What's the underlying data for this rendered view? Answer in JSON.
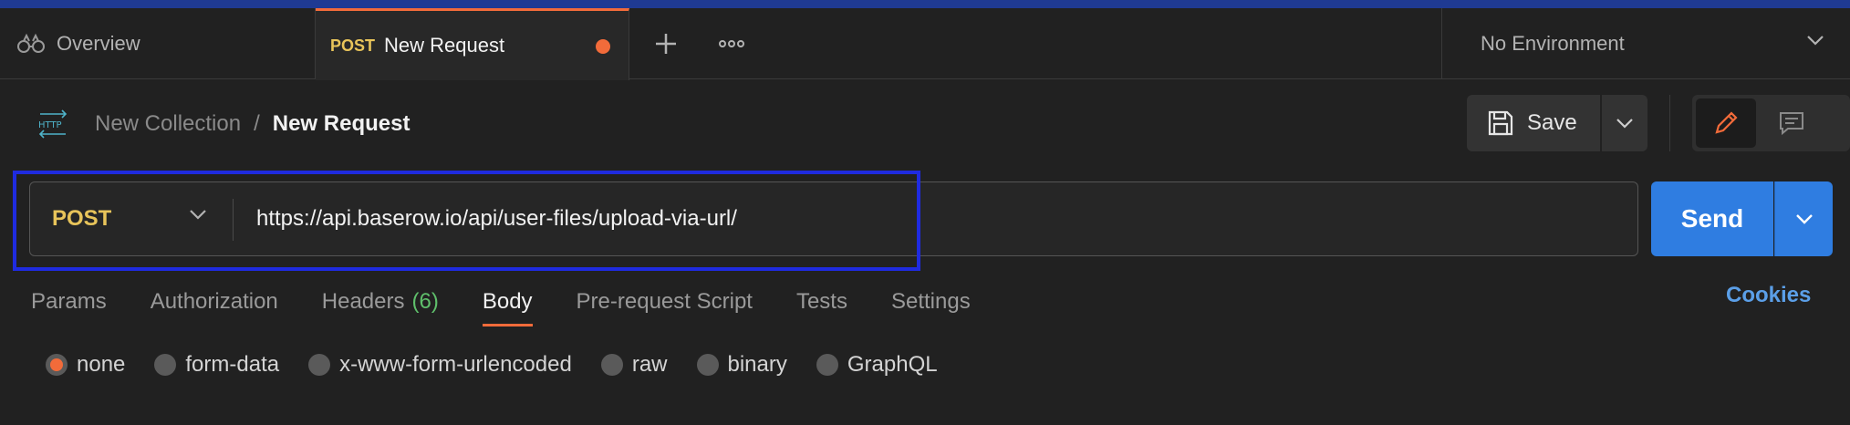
{
  "tabs": {
    "overview_label": "Overview",
    "active_method": "POST",
    "active_label": "New Request",
    "environment": "No Environment"
  },
  "breadcrumb": {
    "collection": "New Collection",
    "separator": "/",
    "request": "New Request"
  },
  "toolbar": {
    "save_label": "Save"
  },
  "request": {
    "method": "POST",
    "url": "https://api.baserow.io/api/user-files/upload-via-url/",
    "send_label": "Send"
  },
  "request_tabs": {
    "params": "Params",
    "authorization": "Authorization",
    "headers": "Headers",
    "headers_count": "(6)",
    "body": "Body",
    "prerequest": "Pre-request Script",
    "tests": "Tests",
    "settings": "Settings",
    "cookies": "Cookies"
  },
  "body_options": {
    "none": "none",
    "form_data": "form-data",
    "urlencoded": "x-www-form-urlencoded",
    "raw": "raw",
    "binary": "binary",
    "graphql": "GraphQL",
    "selected": "none"
  },
  "colors": {
    "accent": "#f26b3a",
    "send": "#2f7de1",
    "method": "#e8c45a",
    "highlight": "#1f2be0"
  }
}
